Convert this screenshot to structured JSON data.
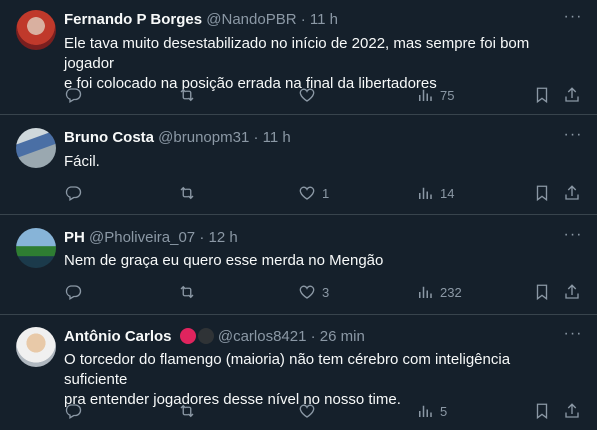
{
  "tweets": [
    {
      "name": "Fernando P Borges",
      "handle": "@NandoPBR",
      "separator": "·",
      "time": "11 h",
      "text_lines": [
        "Ele tava muito desestabilizado no início de 2022, mas sempre foi bom jogador",
        "e foi colocado na posição errada na final da libertadores"
      ],
      "replies": "",
      "retweets": "",
      "likes": "",
      "views": "75"
    },
    {
      "name": "Bruno Costa",
      "handle": "@brunopm31",
      "separator": "·",
      "time": "11 h",
      "text_lines": [
        "Fácil."
      ],
      "replies": "",
      "retweets": "",
      "likes": "1",
      "views": "14"
    },
    {
      "name": "PH",
      "handle": "@Pholiveira_07",
      "separator": "·",
      "time": "12 h",
      "text_lines": [
        "Nem de graça eu quero esse merda no Mengão"
      ],
      "replies": "",
      "retweets": "",
      "likes": "3",
      "views": "232"
    },
    {
      "name": "Antônio Carlos",
      "handle": "@carlos8421",
      "separator": "·",
      "time": "26 min",
      "text_lines": [
        "O torcedor do flamengo (maioria) não tem cérebro com inteligência suficiente",
        "pra entender jogadores desse nível no nosso time."
      ],
      "replies": "",
      "retweets": "",
      "likes": "",
      "views": "5",
      "badge_colors": [
        "#e0245e",
        "#2f3336"
      ]
    }
  ],
  "colors": {
    "background": "#15202b",
    "divider": "#38444d",
    "secondary_text": "#8b98a5",
    "primary_text": "#f7f9f9"
  },
  "icons": [
    "more-icon",
    "reply-icon",
    "retweet-icon",
    "like-icon",
    "views-icon",
    "bookmark-icon",
    "share-icon"
  ]
}
